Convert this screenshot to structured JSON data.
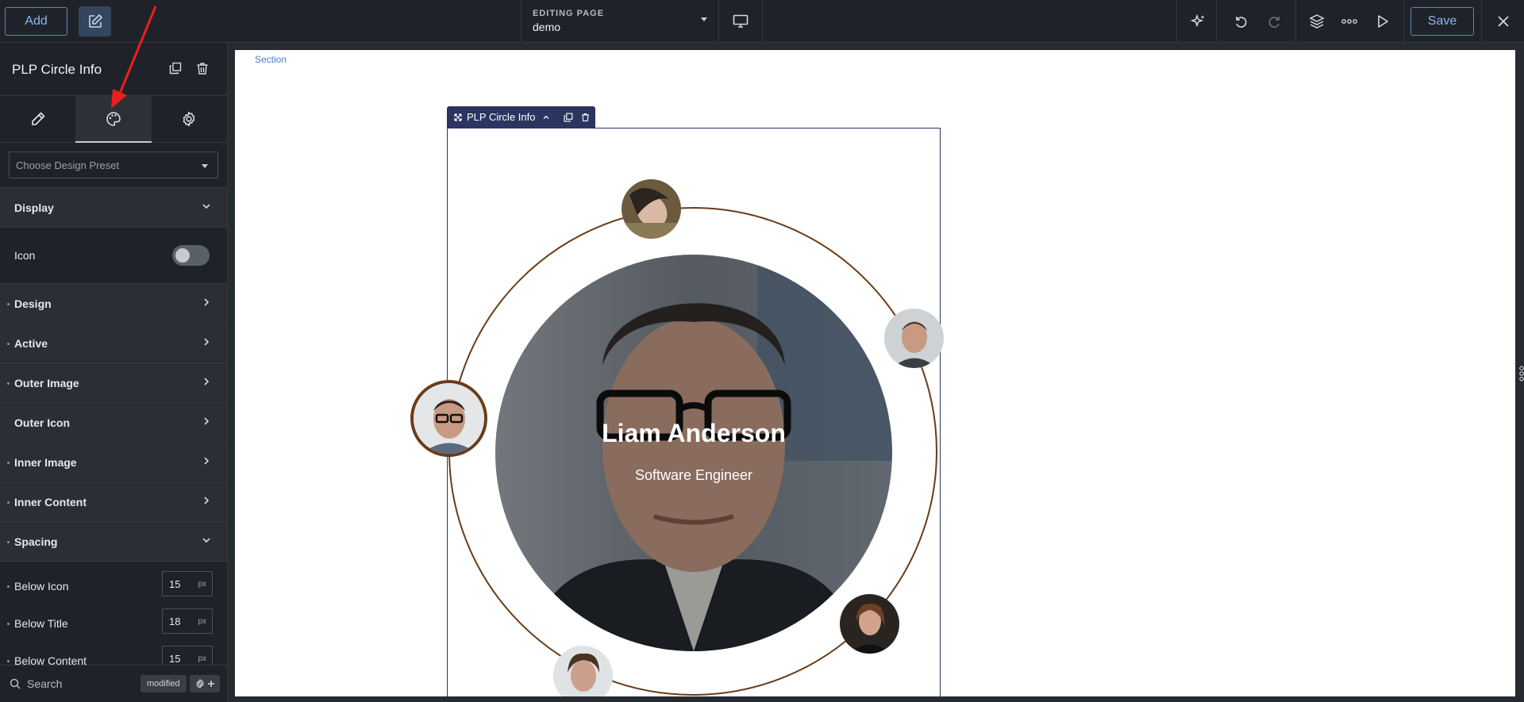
{
  "topbar": {
    "add_label": "Add",
    "editing_label": "EDITING PAGE",
    "editing_value": "demo",
    "save_label": "Save"
  },
  "sidebar": {
    "title": "PLP Circle Info",
    "tabs": [
      "content",
      "style",
      "advanced"
    ],
    "active_tab": "style",
    "preset_placeholder": "Choose Design Preset",
    "display_label": "Display",
    "icon_label": "Icon",
    "icon_toggle_on": false,
    "sections": [
      {
        "label": "Design"
      },
      {
        "label": "Active"
      },
      {
        "label": "Outer Image"
      },
      {
        "label": "Outer Icon"
      },
      {
        "label": "Inner Image"
      },
      {
        "label": "Inner Content"
      }
    ],
    "spacing_label": "Spacing",
    "spacing": {
      "below_icon_label": "Below Icon",
      "below_icon_value": "15",
      "below_icon_unit": "px",
      "below_title_label": "Below Title",
      "below_title_value": "18",
      "below_title_unit": "px",
      "below_content_label": "Below Content",
      "below_content_value": "15",
      "below_content_unit": "px"
    },
    "search_label": "Search",
    "modified_label": "modified"
  },
  "canvas": {
    "section_label": "Section",
    "widget_label": "PLP Circle Info",
    "person_name": "Liam Anderson",
    "person_role": "Software Engineer"
  },
  "colors": {
    "accent": "#5a86c4",
    "ring": "#6a3c18",
    "widget_bar": "#2a3560",
    "annotation_arrow": "#e8201c"
  }
}
